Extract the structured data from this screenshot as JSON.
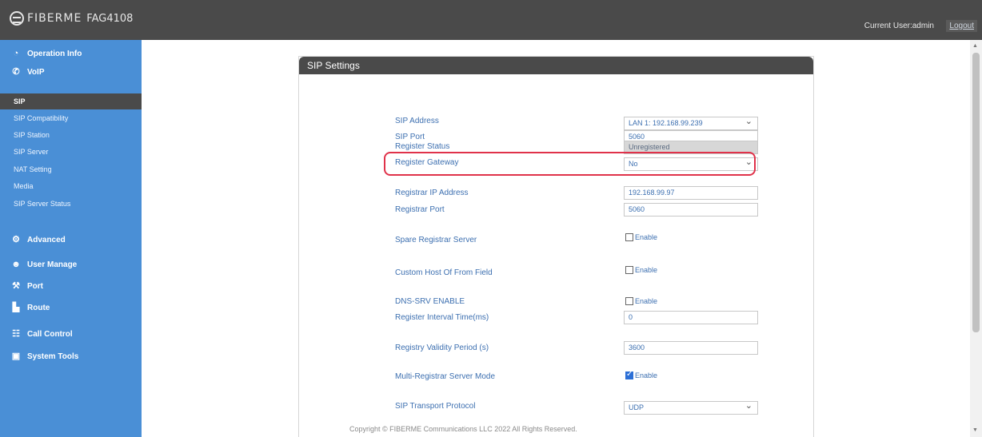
{
  "header": {
    "brand": "FIBERME",
    "model": "FAG4108",
    "user_text": "Current User:admin",
    "logout_label": "Logout"
  },
  "sidebar": {
    "items": [
      {
        "label": "Operation Info",
        "icon": "gauge-icon"
      },
      {
        "label": "VoIP",
        "icon": "phone-icon"
      },
      {
        "label": "Advanced",
        "icon": "gear-icon"
      },
      {
        "label": "User Manage",
        "icon": "user-icon"
      },
      {
        "label": "Port",
        "icon": "port-icon"
      },
      {
        "label": "Route",
        "icon": "route-icon"
      },
      {
        "label": "Call Control",
        "icon": "call-control-icon"
      },
      {
        "label": "System Tools",
        "icon": "tools-icon"
      }
    ],
    "voip_sub": [
      "SIP",
      "SIP Compatibility",
      "SIP Station",
      "SIP Server",
      "NAT Setting",
      "Media",
      "SIP Server Status"
    ]
  },
  "panel": {
    "title": "SIP Settings",
    "fields": {
      "sip_address_label": "SIP Address",
      "sip_address_value": "LAN 1: 192.168.99.239",
      "sip_port_label": "SIP Port",
      "sip_port_value": "5060",
      "register_status_label": "Register Status",
      "register_status_value": "Unregistered",
      "register_gateway_label": "Register Gateway",
      "register_gateway_value": "No",
      "registrar_ip_label": "Registrar IP Address",
      "registrar_ip_value": "192.168.99.97",
      "registrar_port_label": "Registrar Port",
      "registrar_port_value": "5060",
      "spare_registrar_label": "Spare Registrar Server",
      "custom_host_label": "Custom Host Of From Field",
      "dns_srv_label": "DNS-SRV ENABLE",
      "register_interval_label": "Register Interval Time(ms)",
      "register_interval_value": "0",
      "registry_validity_label": "Registry Validity Period (s)",
      "registry_validity_value": "3600",
      "multi_registrar_label": "Multi-Registrar Server Mode",
      "transport_label": "SIP Transport Protocol",
      "transport_value": "UDP",
      "enable_label": "Enable"
    }
  },
  "footer": {
    "copyright": "Copyright © FIBERME Communications LLC 2022 All Rights Reserved."
  }
}
